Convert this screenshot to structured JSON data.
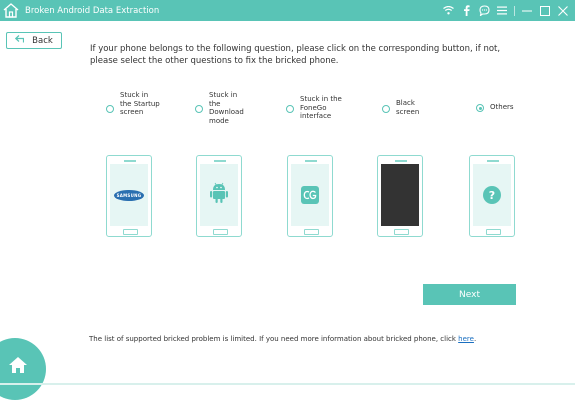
{
  "app": {
    "title": "Broken Android Data Extraction"
  },
  "titlebar_icons": [
    "wifi-icon",
    "facebook-icon",
    "chat-icon",
    "menu-icon",
    "minimize-icon",
    "restore-icon",
    "close-icon"
  ],
  "back": {
    "label": "Back"
  },
  "instructions": "If your phone belongs to the following question, please click on the corresponding button, if not, please select the other questions to fix the bricked phone.",
  "options": [
    {
      "label": "Stuck in the Startup screen",
      "selected": false
    },
    {
      "label": "Stuck in the Download mode",
      "selected": false
    },
    {
      "label": "Stuck in the FoneGo interface",
      "selected": false
    },
    {
      "label": "Black screen",
      "selected": false
    },
    {
      "label": "Others",
      "selected": true
    }
  ],
  "phones": {
    "samsung_text": "SAMSUNG",
    "others_symbol": "?"
  },
  "next": {
    "label": "Next"
  },
  "footnote": {
    "text": "The list of supported bricked problem is limited. If you need more information about bricked phone, click ",
    "link": "here",
    "end": "."
  },
  "colors": {
    "accent": "#59c4b6",
    "phone_border": "#8fdad0",
    "screen": "#e6f6f4",
    "link": "#1a6fc0"
  }
}
